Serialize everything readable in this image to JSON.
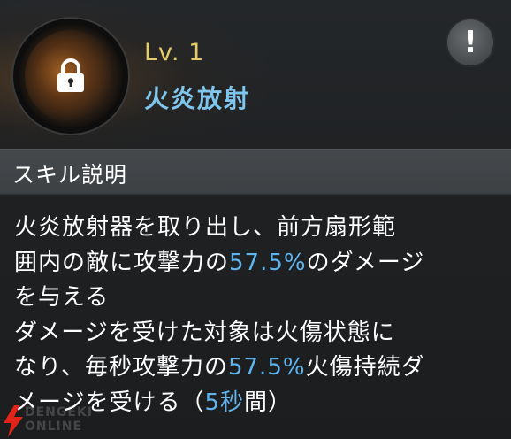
{
  "skill": {
    "level": "Lv. 1",
    "name": "火炎放射",
    "icon": "lock-icon",
    "locked": true
  },
  "alert": {
    "label": "!"
  },
  "section": {
    "title": "スキル説明"
  },
  "description": {
    "lines": [
      [
        {
          "text": "火炎放射器を取り出し、前方扇形範"
        }
      ],
      [
        {
          "text": "囲内の敵に攻撃力の"
        },
        {
          "text": "57.5%",
          "highlight": true
        },
        {
          "text": "のダメージ"
        }
      ],
      [
        {
          "text": "を与える"
        }
      ],
      [
        {
          "text": "ダメージを受けた対象は火傷状態に"
        }
      ],
      [
        {
          "text": "なり、毎秒攻撃力の"
        },
        {
          "text": "57.5%",
          "highlight": true
        },
        {
          "text": "火傷持続ダ"
        }
      ],
      [
        {
          "text": "メージを受ける（"
        },
        {
          "text": "5秒",
          "highlight": true
        },
        {
          "text": "間）"
        }
      ]
    ]
  },
  "watermark": {
    "line1": "DENGEKI",
    "line2": "ONLINE"
  },
  "colors": {
    "level": "#e4cc6a",
    "skill_name": "#7fc6ee",
    "highlight": "#5fb4ee"
  }
}
